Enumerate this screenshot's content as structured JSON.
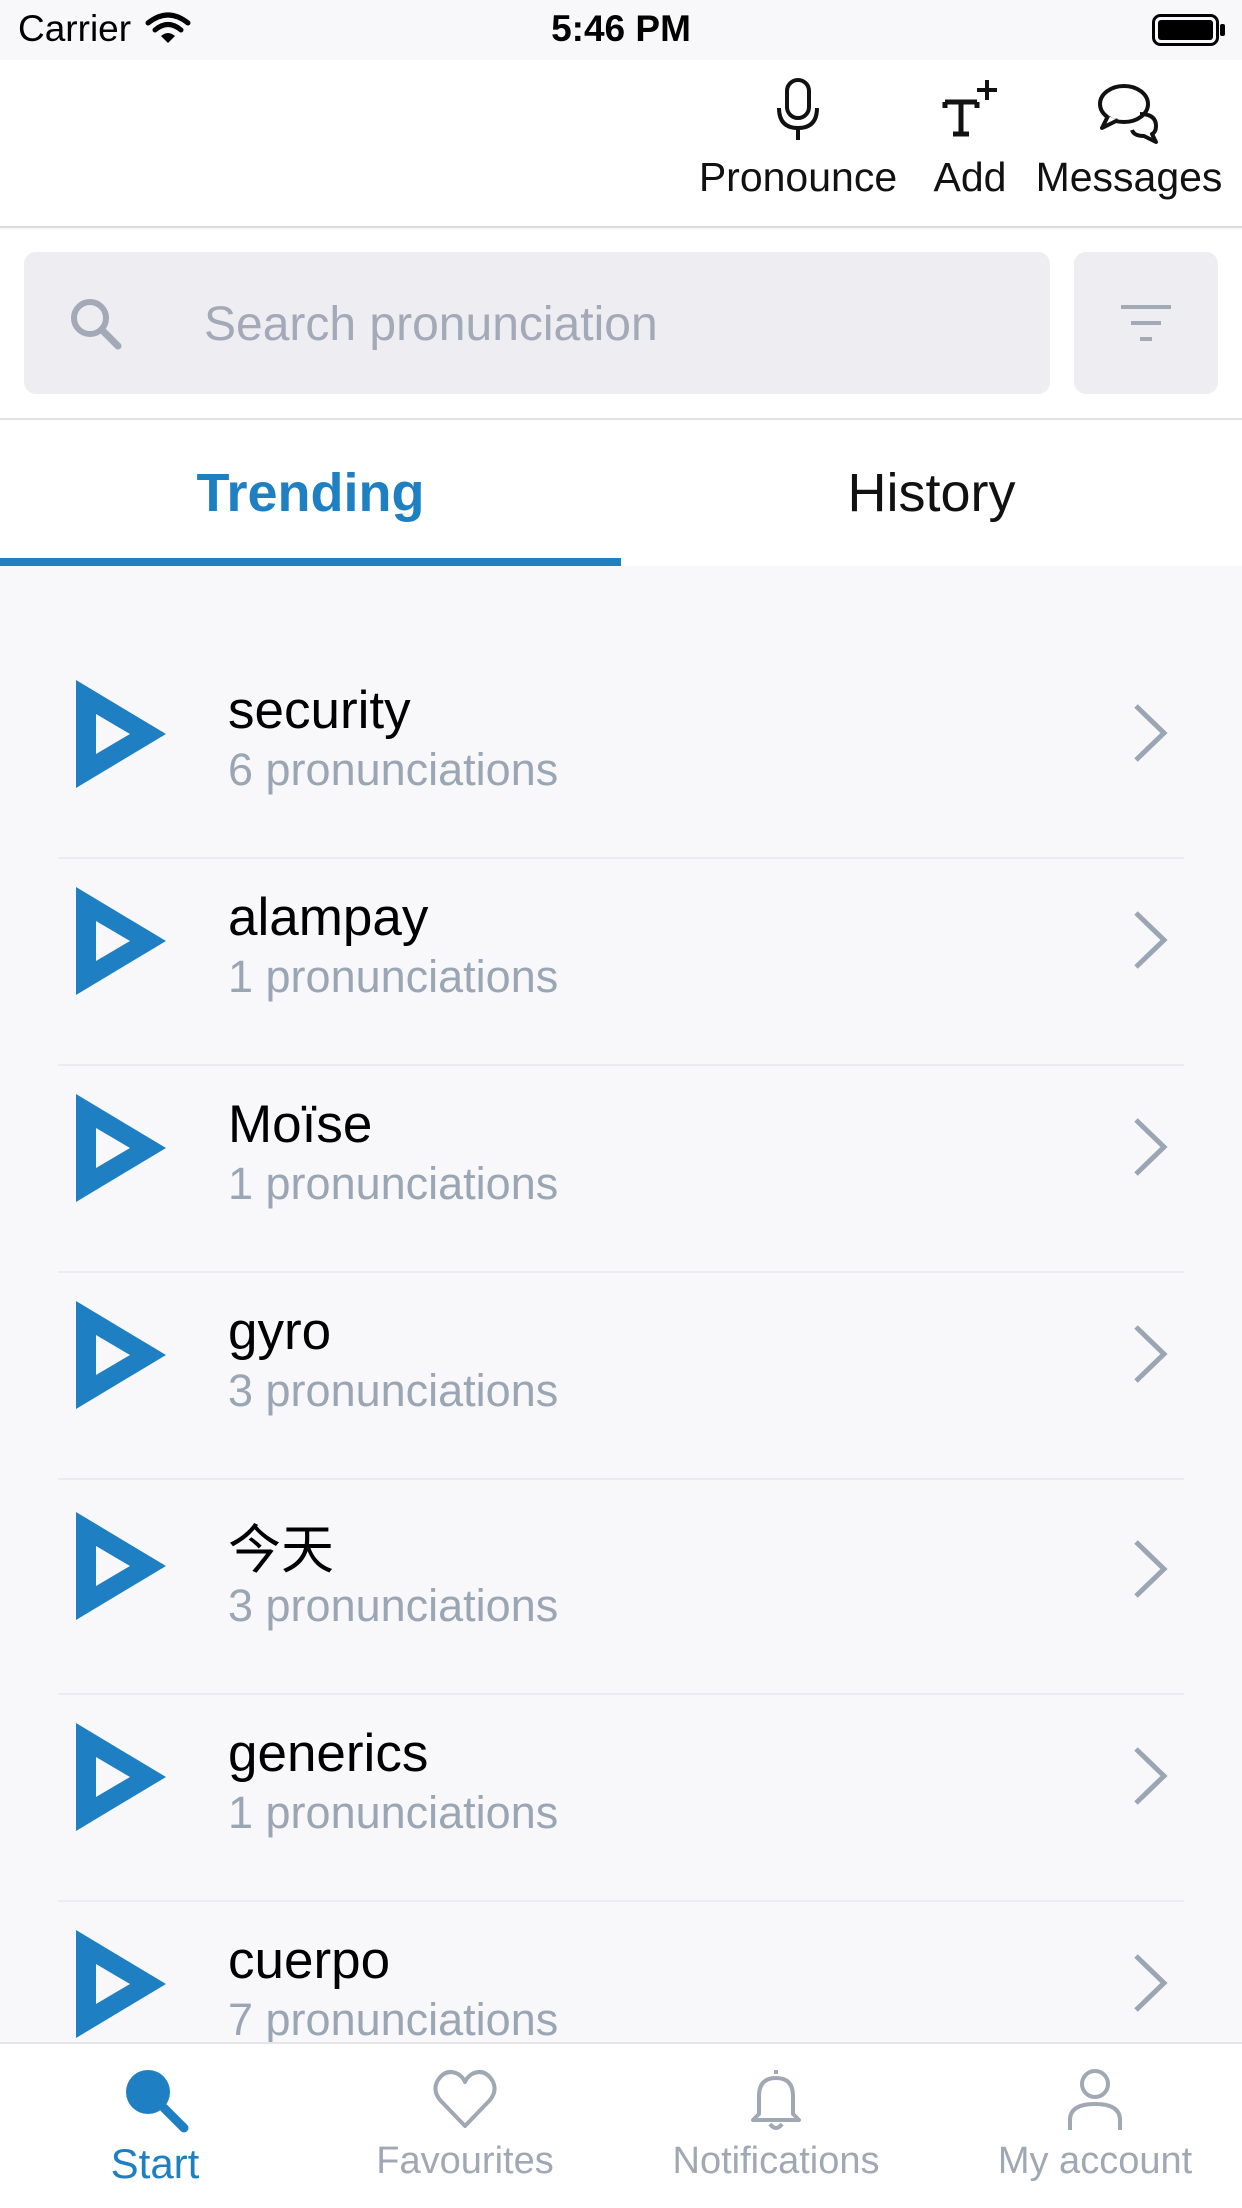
{
  "status_bar": {
    "carrier": "Carrier",
    "time": "5:46 PM"
  },
  "actions": {
    "pronounce": "Pronounce",
    "add": "Add",
    "messages": "Messages"
  },
  "search": {
    "placeholder": "Search pronunciation"
  },
  "tabs": {
    "trending": "Trending",
    "history": "History",
    "active": "Trending"
  },
  "list": [
    {
      "word": "security",
      "count": "6 pronunciations"
    },
    {
      "word": "alampay",
      "count": "1 pronunciations"
    },
    {
      "word": "Moïse",
      "count": "1 pronunciations"
    },
    {
      "word": "gyro",
      "count": "3 pronunciations"
    },
    {
      "word": "今天",
      "count": "3 pronunciations"
    },
    {
      "word": "generics",
      "count": "1 pronunciations"
    },
    {
      "word": "cuerpo",
      "count": "7 pronunciations"
    }
  ],
  "bottom_nav": {
    "start": "Start",
    "favourites": "Favourites",
    "notifications": "Notifications",
    "account": "My account",
    "active": "Start"
  },
  "colors": {
    "accent": "#1e7fc2",
    "muted": "#9ba6b4",
    "background": "#f8f8fb"
  }
}
